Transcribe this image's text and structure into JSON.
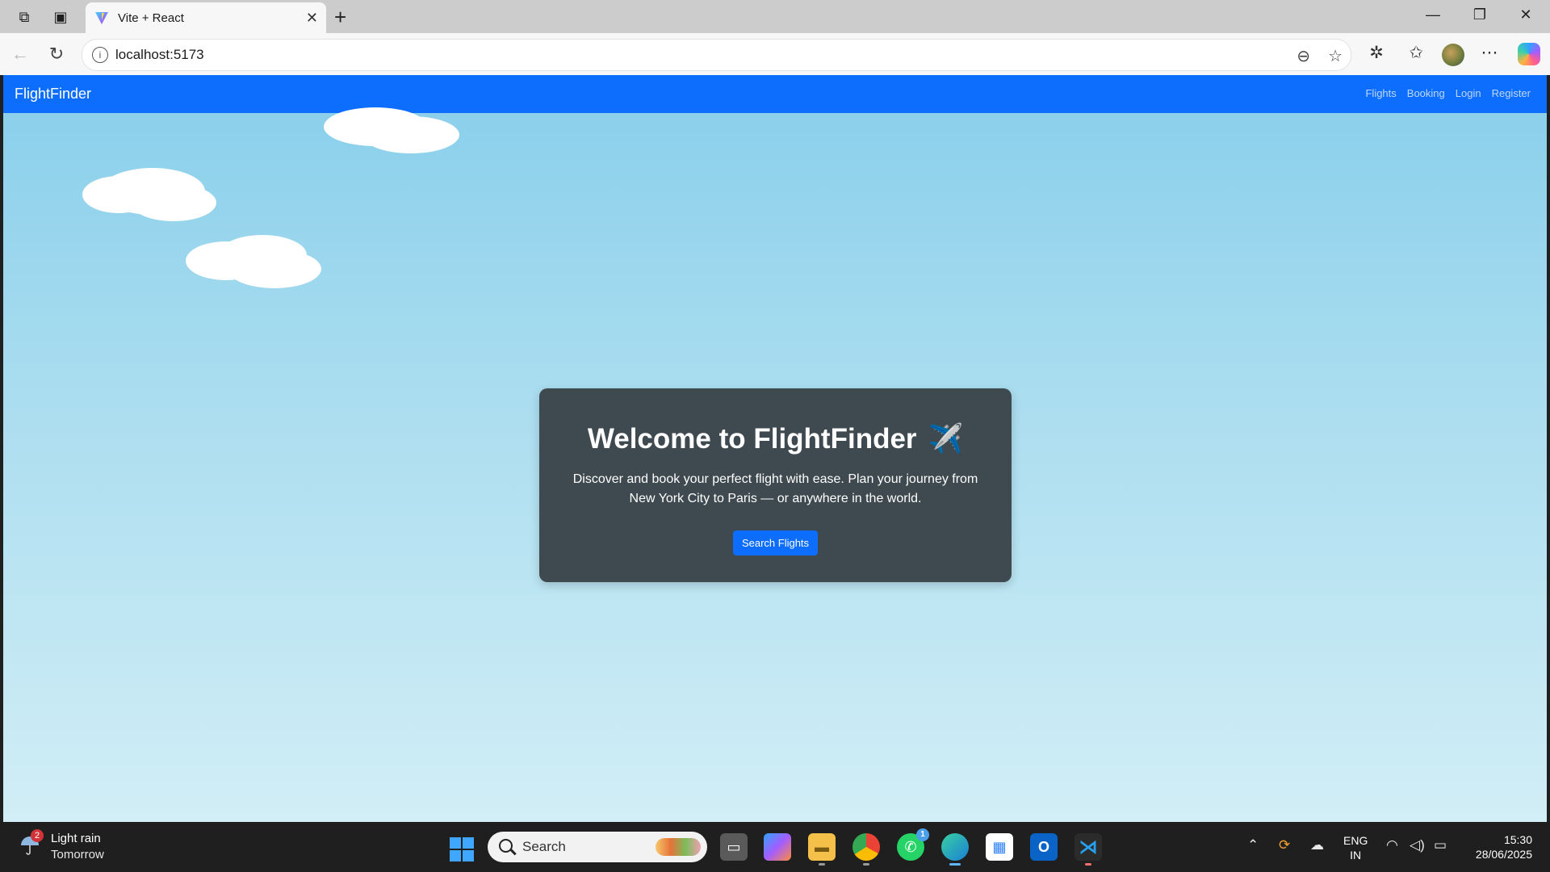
{
  "browser": {
    "tab_title": "Vite + React",
    "url": "localhost:5173"
  },
  "site": {
    "brand": "FlightFinder",
    "nav_links": [
      "Flights",
      "Booking",
      "Login",
      "Register"
    ],
    "hero": {
      "title": "Welcome to FlightFinder",
      "title_emoji": "✈️",
      "description": "Discover and book your perfect flight with ease. Plan your journey from New York City to Paris — or anywhere in the world.",
      "button_label": "Search Flights"
    },
    "colors": {
      "navbar": "#0d6efd",
      "card": "#3f4a50",
      "sky_top": "#87ceeb",
      "sky_bottom": "#d2eef6"
    }
  },
  "taskbar": {
    "weather_badge": "2",
    "weather_main": "Light rain",
    "weather_sub": "Tomorrow",
    "search_placeholder": "Search",
    "whatsapp_badge": "1",
    "lang_top": "ENG",
    "lang_bottom": "IN",
    "time": "15:30",
    "date": "28/06/2025"
  }
}
